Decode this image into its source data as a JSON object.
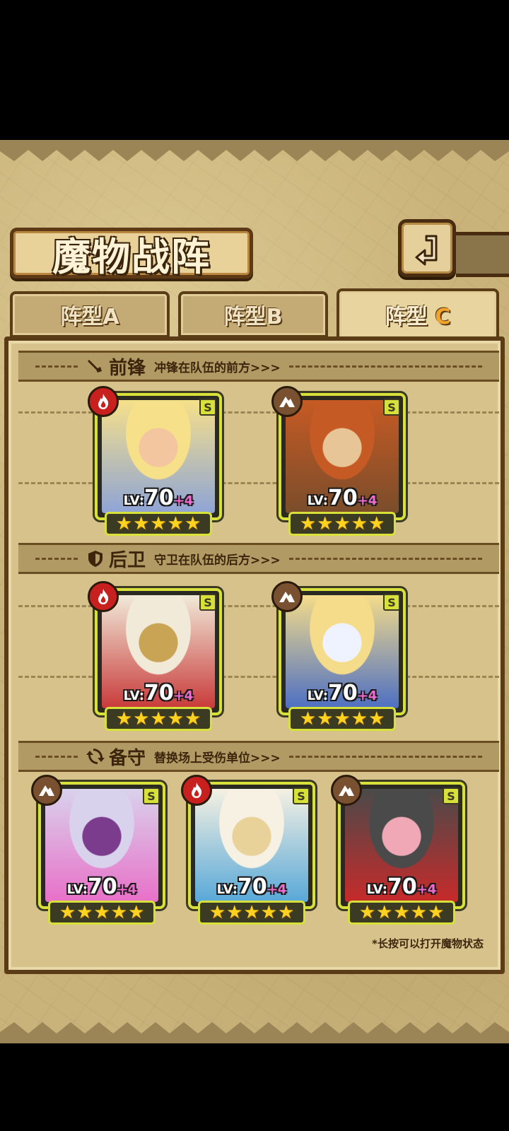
{
  "header": {
    "title": "魔物战阵",
    "back_icon": "back-arrow-icon"
  },
  "tabs": [
    {
      "label_main": "阵型",
      "label_letter": "A",
      "active": false
    },
    {
      "label_main": "阵型",
      "label_letter": "B",
      "active": false
    },
    {
      "label_main": "阵型",
      "label_letter": "C",
      "active": true
    }
  ],
  "sections": {
    "front": {
      "title": "前锋",
      "desc": "冲锋在队伍的前方>>>",
      "icon": "sword-icon"
    },
    "back": {
      "title": "后卫",
      "desc": "守卫在队伍的后方>>>",
      "icon": "shield-icon"
    },
    "reserve": {
      "title": "备守",
      "desc": "替换场上受伤单位>>>",
      "icon": "swap-icon"
    }
  },
  "units": {
    "front": [
      {
        "element": "fire",
        "rarity": "S",
        "lv_label": "LV:",
        "level": "70",
        "bonus": "+4",
        "stars": 5,
        "colors": [
          "#f6e08a",
          "#f3c6a0",
          "#8ea4d6"
        ]
      },
      {
        "element": "earth",
        "rarity": "S",
        "lv_label": "LV:",
        "level": "70",
        "bonus": "+4",
        "stars": 5,
        "colors": [
          "#c65a24",
          "#e8c596",
          "#7a4d2a"
        ]
      }
    ],
    "back": [
      {
        "element": "fire",
        "rarity": "S",
        "lv_label": "LV:",
        "level": "70",
        "bonus": "+4",
        "stars": 5,
        "colors": [
          "#f1ead8",
          "#c9a454",
          "#c83a3a"
        ]
      },
      {
        "element": "earth",
        "rarity": "S",
        "lv_label": "LV:",
        "level": "70",
        "bonus": "+4",
        "stars": 5,
        "colors": [
          "#f4dc8a",
          "#eef3ff",
          "#4d6fc3"
        ]
      }
    ],
    "reserve": [
      {
        "element": "earth",
        "rarity": "S",
        "lv_label": "LV:",
        "level": "70",
        "bonus": "+4",
        "stars": 5,
        "colors": [
          "#d9d2ec",
          "#7c3c8e",
          "#e870c8"
        ]
      },
      {
        "element": "fire",
        "rarity": "S",
        "lv_label": "LV:",
        "level": "70",
        "bonus": "+4",
        "stars": 5,
        "colors": [
          "#f6f1e2",
          "#e9d19a",
          "#58a8d8"
        ]
      },
      {
        "element": "earth",
        "rarity": "S",
        "lv_label": "LV:",
        "level": "70",
        "bonus": "+4",
        "stars": 5,
        "colors": [
          "#4a4a4a",
          "#f0a8b6",
          "#c82a2a"
        ]
      }
    ]
  },
  "hint": "*长按可以打开魔物状态"
}
